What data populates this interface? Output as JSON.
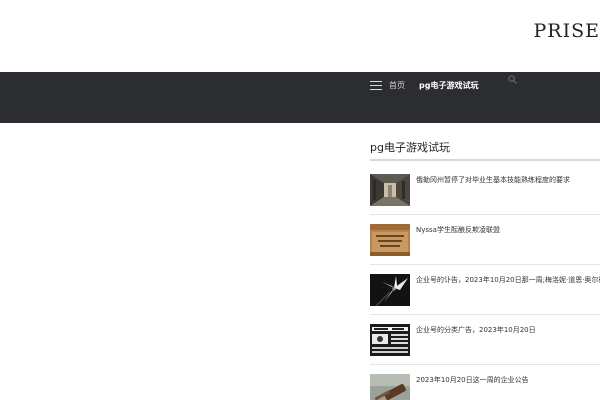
{
  "header": {
    "logo_text": "PRISE"
  },
  "nav": {
    "menu_icon": "hamburger-menu-icon",
    "home_label": "首页",
    "active_label": "pg电子游戏试玩",
    "search_icon": "search-icon"
  },
  "sidebar": {
    "title": "pg电子游戏试玩",
    "posts": [
      {
        "title": "俄勒冈州暂停了对毕业生基本技能熟练程度的要求",
        "thumb": "hallway-photo"
      },
      {
        "title": "Nyssa学生酝酿反欺凌联盟",
        "thumb": "plaque-photo"
      },
      {
        "title": "企业号的讣告，2023年10月20日那一周;梅洛妮·道恩·奥尔德",
        "thumb": "lily-flower-photo"
      },
      {
        "title": "企业号的分类广告，2023年10月20日",
        "thumb": "classified-ads-photo"
      },
      {
        "title": "2023年10月20日这一周的企业公告",
        "thumb": "gavel-photo"
      }
    ]
  },
  "colors": {
    "navbar_bg": "#2b2d31",
    "page_bg": "#ffffff",
    "rule": "#d9d9d9"
  }
}
